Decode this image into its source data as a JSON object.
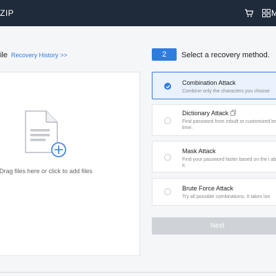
{
  "titlebar": {
    "app_name": "ZIP",
    "cart_icon": "cart-icon",
    "grid_icon": "grid-icon",
    "menu_label": "M"
  },
  "step1": {
    "title": "ile",
    "recovery_link": "Recovery History >>"
  },
  "dropzone": {
    "icon": "file-add-icon",
    "text": "Drag files here or click to add files"
  },
  "step2": {
    "number": "2",
    "title": "Select a recovery method."
  },
  "methods": [
    {
      "name": "Combination Attack",
      "desc": "Combine only the characters you choose",
      "selected": true
    },
    {
      "name": "Dictionary Attack",
      "desc": "Find password from inbuilt or customized less time.",
      "selected": false,
      "icon": "copy-icon"
    },
    {
      "name": "Mask Attack",
      "desc": "Find your password faster based on the i about it.",
      "selected": false
    },
    {
      "name": "Brute Force Attack",
      "desc": "Try all possible combinations. It takes lon",
      "selected": false
    }
  ],
  "next_button": {
    "label": "Next",
    "enabled": false
  },
  "colors": {
    "accent": "#2f7cdf",
    "titlebar": "#1f2a3a",
    "selected_bg": "#eaf2fd",
    "disabled_button": "#cfd3d8"
  }
}
